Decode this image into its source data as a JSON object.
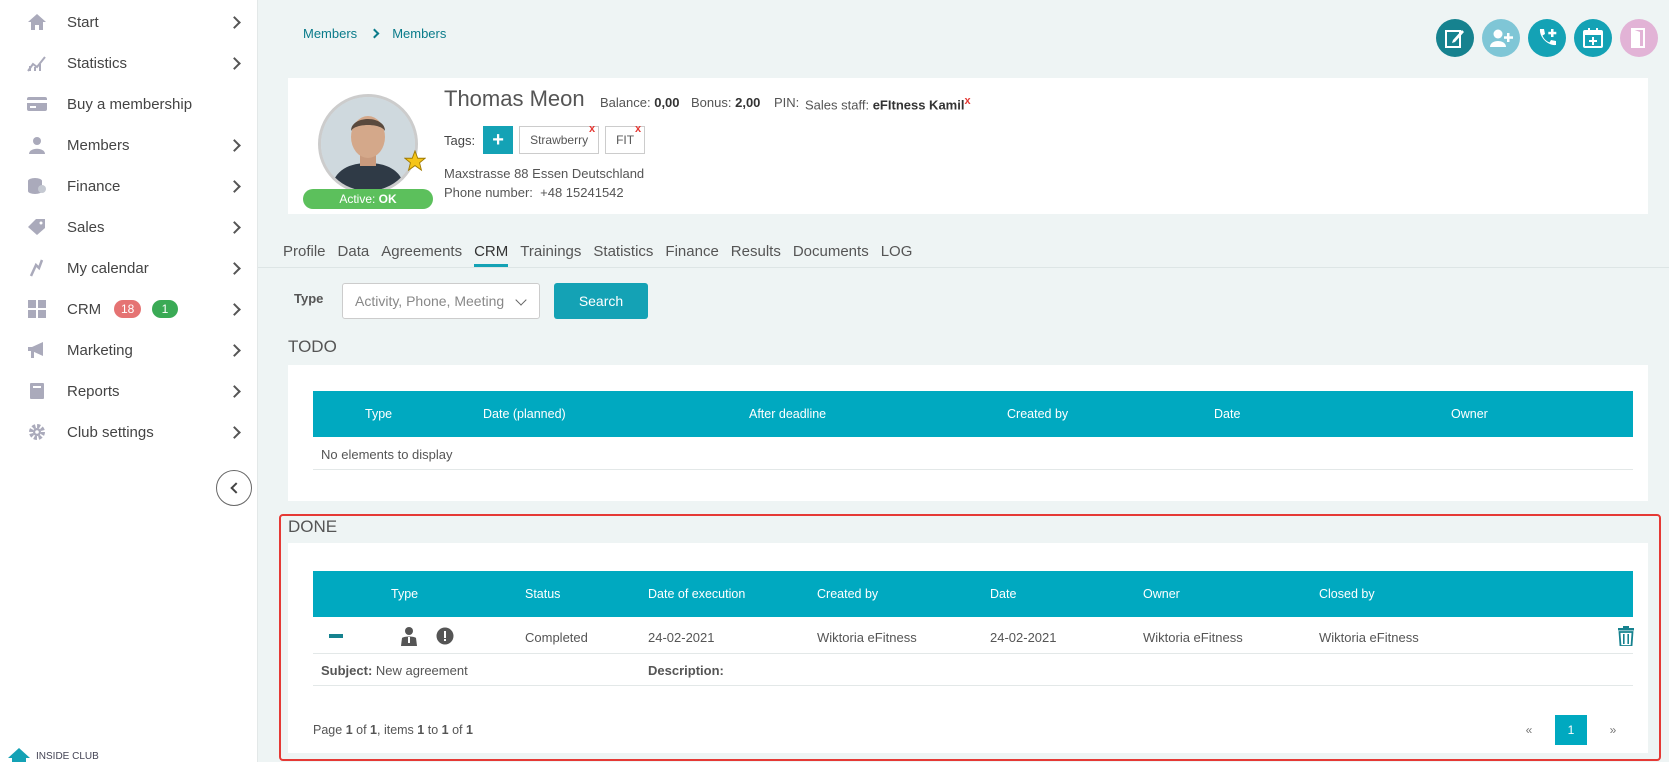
{
  "sidebar": {
    "items": [
      {
        "label": "Start",
        "icon": "home-icon"
      },
      {
        "label": "Statistics",
        "icon": "chart-icon"
      },
      {
        "label": "Buy a membership",
        "icon": "card-icon"
      },
      {
        "label": "Members",
        "icon": "user-icon"
      },
      {
        "label": "Finance",
        "icon": "coins-icon"
      },
      {
        "label": "Sales",
        "icon": "tag-icon"
      },
      {
        "label": "My calendar",
        "icon": "calendar-icon"
      },
      {
        "label": "CRM",
        "icon": "grid-icon"
      },
      {
        "label": "Marketing",
        "icon": "megaphone-icon"
      },
      {
        "label": "Reports",
        "icon": "book-icon"
      },
      {
        "label": "Club settings",
        "icon": "gear-icon"
      }
    ],
    "crm_badges": {
      "red": "18",
      "green": "1"
    },
    "brand": "INSIDE CLUB"
  },
  "breadcrumb": {
    "first": "Members",
    "second": "Members"
  },
  "member": {
    "name": "Thomas Meon",
    "balance_label": "Balance:",
    "balance": "0,00",
    "bonus_label": "Bonus:",
    "bonus": "2,00",
    "pin_label": "PIN:",
    "sales_label": "Sales staff:",
    "sales_staff": "eFItness Kamil",
    "tags_label": "Tags:",
    "tags": [
      "Strawberry",
      "FIT"
    ],
    "address": "Maxstrasse 88 Essen Deutschland",
    "phone_label": "Phone number:",
    "phone": "+48 15241542",
    "status_prefix": "Active:",
    "status": "OK"
  },
  "tabs": [
    "Profile",
    "Data",
    "Agreements",
    "CRM",
    "Trainings",
    "Statistics",
    "Finance",
    "Results",
    "Documents",
    "LOG"
  ],
  "active_tab": "CRM",
  "filter": {
    "label": "Type",
    "placeholder": "Activity, Phone, Meeting",
    "search_label": "Search"
  },
  "todo": {
    "title": "TODO",
    "columns": [
      "Type",
      "Date (planned)",
      "After deadline",
      "Created by",
      "Date",
      "Owner"
    ],
    "empty": "No elements to display"
  },
  "done": {
    "title": "DONE",
    "columns": [
      "Type",
      "Status",
      "Date of execution",
      "Created by",
      "Date",
      "Owner",
      "Closed by"
    ],
    "row": {
      "status": "Completed",
      "date_exec": "24-02-2021",
      "created_by": "Wiktoria eFitness",
      "date": "24-02-2021",
      "owner": "Wiktoria eFitness",
      "closed_by": "Wiktoria eFitness",
      "subject_label": "Subject:",
      "subject": "New agreement",
      "description_label": "Description:"
    },
    "pager": {
      "page_word": "Page",
      "page": "1",
      "of_word": "of",
      "pages": "1",
      "items_word": ", items",
      "from": "1",
      "to_word": "to",
      "to": "1",
      "of2": "of",
      "total": "1",
      "prev": "«",
      "current": "1",
      "next": "»"
    }
  },
  "colors": {
    "accent": "#00a9c0",
    "highlight": "#e53935",
    "status_ok": "#5cc05c"
  }
}
